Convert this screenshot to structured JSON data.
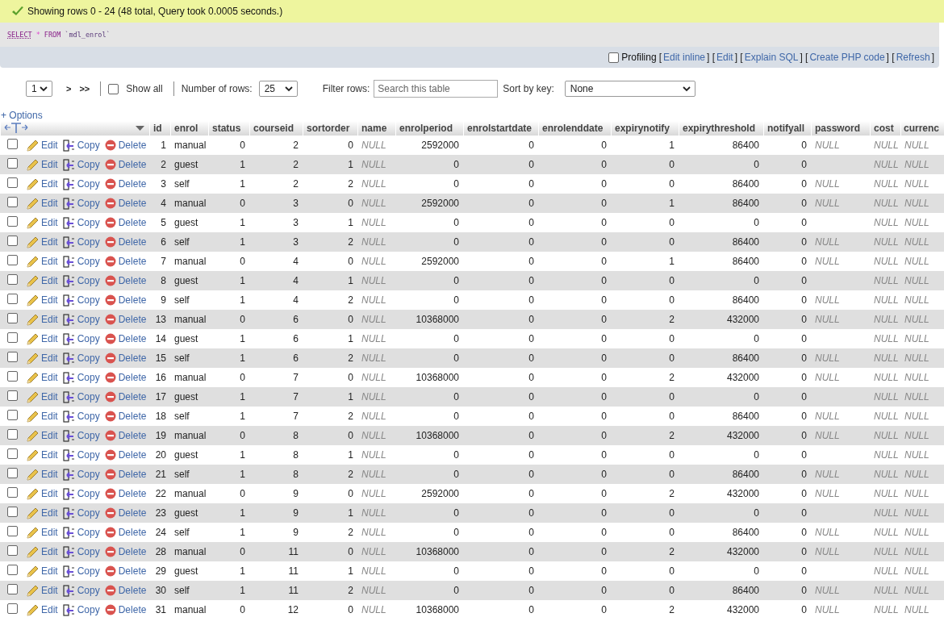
{
  "message": {
    "text": "Showing rows 0 - 24 (48 total, Query took 0.0005 seconds.)"
  },
  "sql": {
    "keyword1": "SELECT",
    "star": "*",
    "keyword2": "FROM",
    "table": "`mdl_enrol`"
  },
  "query_links": {
    "profiling": {
      "label": "Profiling",
      "checked": false
    },
    "items": [
      {
        "kind": "bracket",
        "text": "["
      },
      {
        "kind": "link",
        "text": "Edit inline"
      },
      {
        "kind": "bracket",
        "text": "] ["
      },
      {
        "kind": "link",
        "text": "Edit"
      },
      {
        "kind": "bracket",
        "text": "] ["
      },
      {
        "kind": "link",
        "text": "Explain SQL"
      },
      {
        "kind": "bracket",
        "text": "] ["
      },
      {
        "kind": "link",
        "text": "Create PHP code"
      },
      {
        "kind": "bracket",
        "text": "] ["
      },
      {
        "kind": "link",
        "text": "Refresh"
      },
      {
        "kind": "bracket",
        "text": "]"
      }
    ]
  },
  "navigation": {
    "page": "1",
    "next": ">",
    "last": ">>",
    "show_all": {
      "label": "Show all",
      "checked": false
    },
    "rows_label": "Number of rows:",
    "rows_value": "25",
    "filter_label": "Filter rows:",
    "filter_placeholder": "Search this table",
    "sort_label": "Sort by key:",
    "sort_value": "None"
  },
  "options": "+ Options",
  "table": {
    "columns": [
      "id",
      "enrol",
      "status",
      "courseid",
      "sortorder",
      "name",
      "enrolperiod",
      "enrolstartdate",
      "enrolenddate",
      "expirynotify",
      "expirythreshold",
      "notifyall",
      "password",
      "cost",
      "currenc"
    ],
    "rows": [
      {
        "checked": false,
        "actions": [
          "Edit",
          "Copy",
          "Delete"
        ],
        "cells": [
          "1",
          "manual",
          "0",
          "2",
          "0",
          {
            "text": "NULL",
            "kind": "null"
          },
          "2592000",
          "0",
          "0",
          "1",
          "86400",
          "0",
          {
            "text": "NULL",
            "kind": "null"
          },
          {
            "text": "NULL",
            "kind": "null"
          },
          {
            "text": "NULL",
            "kind": "null"
          }
        ]
      },
      {
        "checked": false,
        "actions": [
          "Edit",
          "Copy",
          "Delete"
        ],
        "cells": [
          "2",
          "guest",
          "1",
          "2",
          "1",
          {
            "text": "NULL",
            "kind": "null"
          },
          "0",
          "0",
          "0",
          "0",
          "0",
          "0",
          {
            "kind": "empty"
          },
          {
            "text": "NULL",
            "kind": "null"
          },
          {
            "text": "NULL",
            "kind": "null"
          }
        ]
      },
      {
        "checked": false,
        "actions": [
          "Edit",
          "Copy",
          "Delete"
        ],
        "cells": [
          "3",
          "self",
          "1",
          "2",
          "2",
          {
            "text": "NULL",
            "kind": "null"
          },
          "0",
          "0",
          "0",
          "0",
          "86400",
          "0",
          {
            "text": "NULL",
            "kind": "null"
          },
          {
            "text": "NULL",
            "kind": "null"
          },
          {
            "text": "NULL",
            "kind": "null"
          }
        ]
      },
      {
        "checked": false,
        "actions": [
          "Edit",
          "Copy",
          "Delete"
        ],
        "cells": [
          "4",
          "manual",
          "0",
          "3",
          "0",
          {
            "text": "NULL",
            "kind": "null"
          },
          "2592000",
          "0",
          "0",
          "1",
          "86400",
          "0",
          {
            "text": "NULL",
            "kind": "null"
          },
          {
            "text": "NULL",
            "kind": "null"
          },
          {
            "text": "NULL",
            "kind": "null"
          }
        ]
      },
      {
        "checked": false,
        "actions": [
          "Edit",
          "Copy",
          "Delete"
        ],
        "cells": [
          "5",
          "guest",
          "1",
          "3",
          "1",
          {
            "text": "NULL",
            "kind": "null"
          },
          "0",
          "0",
          "0",
          "0",
          "0",
          "0",
          {
            "kind": "empty"
          },
          {
            "text": "NULL",
            "kind": "null"
          },
          {
            "text": "NULL",
            "kind": "null"
          }
        ]
      },
      {
        "checked": false,
        "actions": [
          "Edit",
          "Copy",
          "Delete"
        ],
        "cells": [
          "6",
          "self",
          "1",
          "3",
          "2",
          {
            "text": "NULL",
            "kind": "null"
          },
          "0",
          "0",
          "0",
          "0",
          "86400",
          "0",
          {
            "text": "NULL",
            "kind": "null"
          },
          {
            "text": "NULL",
            "kind": "null"
          },
          {
            "text": "NULL",
            "kind": "null"
          }
        ]
      },
      {
        "checked": false,
        "actions": [
          "Edit",
          "Copy",
          "Delete"
        ],
        "cells": [
          "7",
          "manual",
          "0",
          "4",
          "0",
          {
            "text": "NULL",
            "kind": "null"
          },
          "2592000",
          "0",
          "0",
          "1",
          "86400",
          "0",
          {
            "text": "NULL",
            "kind": "null"
          },
          {
            "text": "NULL",
            "kind": "null"
          },
          {
            "text": "NULL",
            "kind": "null"
          }
        ]
      },
      {
        "checked": false,
        "actions": [
          "Edit",
          "Copy",
          "Delete"
        ],
        "cells": [
          "8",
          "guest",
          "1",
          "4",
          "1",
          {
            "text": "NULL",
            "kind": "null"
          },
          "0",
          "0",
          "0",
          "0",
          "0",
          "0",
          {
            "kind": "empty"
          },
          {
            "text": "NULL",
            "kind": "null"
          },
          {
            "text": "NULL",
            "kind": "null"
          }
        ]
      },
      {
        "checked": false,
        "actions": [
          "Edit",
          "Copy",
          "Delete"
        ],
        "cells": [
          "9",
          "self",
          "1",
          "4",
          "2",
          {
            "text": "NULL",
            "kind": "null"
          },
          "0",
          "0",
          "0",
          "0",
          "86400",
          "0",
          {
            "text": "NULL",
            "kind": "null"
          },
          {
            "text": "NULL",
            "kind": "null"
          },
          {
            "text": "NULL",
            "kind": "null"
          }
        ]
      },
      {
        "checked": false,
        "actions": [
          "Edit",
          "Copy",
          "Delete"
        ],
        "cells": [
          "13",
          "manual",
          "0",
          "6",
          "0",
          {
            "text": "NULL",
            "kind": "null"
          },
          "10368000",
          "0",
          "0",
          "2",
          "432000",
          "0",
          {
            "text": "NULL",
            "kind": "null"
          },
          {
            "text": "NULL",
            "kind": "null"
          },
          {
            "text": "NULL",
            "kind": "null"
          }
        ]
      },
      {
        "checked": false,
        "actions": [
          "Edit",
          "Copy",
          "Delete"
        ],
        "cells": [
          "14",
          "guest",
          "1",
          "6",
          "1",
          {
            "text": "NULL",
            "kind": "null"
          },
          "0",
          "0",
          "0",
          "0",
          "0",
          "0",
          {
            "kind": "empty"
          },
          {
            "text": "NULL",
            "kind": "null"
          },
          {
            "text": "NULL",
            "kind": "null"
          }
        ]
      },
      {
        "checked": false,
        "actions": [
          "Edit",
          "Copy",
          "Delete"
        ],
        "cells": [
          "15",
          "self",
          "1",
          "6",
          "2",
          {
            "text": "NULL",
            "kind": "null"
          },
          "0",
          "0",
          "0",
          "0",
          "86400",
          "0",
          {
            "text": "NULL",
            "kind": "null"
          },
          {
            "text": "NULL",
            "kind": "null"
          },
          {
            "text": "NULL",
            "kind": "null"
          }
        ]
      },
      {
        "checked": false,
        "actions": [
          "Edit",
          "Copy",
          "Delete"
        ],
        "cells": [
          "16",
          "manual",
          "0",
          "7",
          "0",
          {
            "text": "NULL",
            "kind": "null"
          },
          "10368000",
          "0",
          "0",
          "2",
          "432000",
          "0",
          {
            "text": "NULL",
            "kind": "null"
          },
          {
            "text": "NULL",
            "kind": "null"
          },
          {
            "text": "NULL",
            "kind": "null"
          }
        ]
      },
      {
        "checked": false,
        "actions": [
          "Edit",
          "Copy",
          "Delete"
        ],
        "cells": [
          "17",
          "guest",
          "1",
          "7",
          "1",
          {
            "text": "NULL",
            "kind": "null"
          },
          "0",
          "0",
          "0",
          "0",
          "0",
          "0",
          {
            "kind": "empty"
          },
          {
            "text": "NULL",
            "kind": "null"
          },
          {
            "text": "NULL",
            "kind": "null"
          }
        ]
      },
      {
        "checked": false,
        "actions": [
          "Edit",
          "Copy",
          "Delete"
        ],
        "cells": [
          "18",
          "self",
          "1",
          "7",
          "2",
          {
            "text": "NULL",
            "kind": "null"
          },
          "0",
          "0",
          "0",
          "0",
          "86400",
          "0",
          {
            "text": "NULL",
            "kind": "null"
          },
          {
            "text": "NULL",
            "kind": "null"
          },
          {
            "text": "NULL",
            "kind": "null"
          }
        ]
      },
      {
        "checked": false,
        "actions": [
          "Edit",
          "Copy",
          "Delete"
        ],
        "cells": [
          "19",
          "manual",
          "0",
          "8",
          "0",
          {
            "text": "NULL",
            "kind": "null"
          },
          "10368000",
          "0",
          "0",
          "2",
          "432000",
          "0",
          {
            "text": "NULL",
            "kind": "null"
          },
          {
            "text": "NULL",
            "kind": "null"
          },
          {
            "text": "NULL",
            "kind": "null"
          }
        ]
      },
      {
        "checked": false,
        "actions": [
          "Edit",
          "Copy",
          "Delete"
        ],
        "cells": [
          "20",
          "guest",
          "1",
          "8",
          "1",
          {
            "text": "NULL",
            "kind": "null"
          },
          "0",
          "0",
          "0",
          "0",
          "0",
          "0",
          {
            "kind": "empty"
          },
          {
            "text": "NULL",
            "kind": "null"
          },
          {
            "text": "NULL",
            "kind": "null"
          }
        ]
      },
      {
        "checked": false,
        "actions": [
          "Edit",
          "Copy",
          "Delete"
        ],
        "cells": [
          "21",
          "self",
          "1",
          "8",
          "2",
          {
            "text": "NULL",
            "kind": "null"
          },
          "0",
          "0",
          "0",
          "0",
          "86400",
          "0",
          {
            "text": "NULL",
            "kind": "null"
          },
          {
            "text": "NULL",
            "kind": "null"
          },
          {
            "text": "NULL",
            "kind": "null"
          }
        ]
      },
      {
        "checked": false,
        "actions": [
          "Edit",
          "Copy",
          "Delete"
        ],
        "cells": [
          "22",
          "manual",
          "0",
          "9",
          "0",
          {
            "text": "NULL",
            "kind": "null"
          },
          "2592000",
          "0",
          "0",
          "2",
          "432000",
          "0",
          {
            "text": "NULL",
            "kind": "null"
          },
          {
            "text": "NULL",
            "kind": "null"
          },
          {
            "text": "NULL",
            "kind": "null"
          }
        ]
      },
      {
        "checked": false,
        "actions": [
          "Edit",
          "Copy",
          "Delete"
        ],
        "cells": [
          "23",
          "guest",
          "1",
          "9",
          "1",
          {
            "text": "NULL",
            "kind": "null"
          },
          "0",
          "0",
          "0",
          "0",
          "0",
          "0",
          {
            "kind": "empty"
          },
          {
            "text": "NULL",
            "kind": "null"
          },
          {
            "text": "NULL",
            "kind": "null"
          }
        ]
      },
      {
        "checked": false,
        "actions": [
          "Edit",
          "Copy",
          "Delete"
        ],
        "cells": [
          "24",
          "self",
          "1",
          "9",
          "2",
          {
            "text": "NULL",
            "kind": "null"
          },
          "0",
          "0",
          "0",
          "0",
          "86400",
          "0",
          {
            "text": "NULL",
            "kind": "null"
          },
          {
            "text": "NULL",
            "kind": "null"
          },
          {
            "text": "NULL",
            "kind": "null"
          }
        ]
      },
      {
        "checked": false,
        "actions": [
          "Edit",
          "Copy",
          "Delete"
        ],
        "cells": [
          "28",
          "manual",
          "0",
          "11",
          "0",
          {
            "text": "NULL",
            "kind": "null"
          },
          "10368000",
          "0",
          "0",
          "2",
          "432000",
          "0",
          {
            "text": "NULL",
            "kind": "null"
          },
          {
            "text": "NULL",
            "kind": "null"
          },
          {
            "text": "NULL",
            "kind": "null"
          }
        ]
      },
      {
        "checked": false,
        "actions": [
          "Edit",
          "Copy",
          "Delete"
        ],
        "cells": [
          "29",
          "guest",
          "1",
          "11",
          "1",
          {
            "text": "NULL",
            "kind": "null"
          },
          "0",
          "0",
          "0",
          "0",
          "0",
          "0",
          {
            "kind": "empty"
          },
          {
            "text": "NULL",
            "kind": "null"
          },
          {
            "text": "NULL",
            "kind": "null"
          }
        ]
      },
      {
        "checked": false,
        "actions": [
          "Edit",
          "Copy",
          "Delete"
        ],
        "cells": [
          "30",
          "self",
          "1",
          "11",
          "2",
          {
            "text": "NULL",
            "kind": "null"
          },
          "0",
          "0",
          "0",
          "0",
          "86400",
          "0",
          {
            "text": "NULL",
            "kind": "null"
          },
          {
            "text": "NULL",
            "kind": "null"
          },
          {
            "text": "NULL",
            "kind": "null"
          }
        ]
      },
      {
        "checked": false,
        "actions": [
          "Edit",
          "Copy",
          "Delete"
        ],
        "cells": [
          "31",
          "manual",
          "0",
          "12",
          "0",
          {
            "text": "NULL",
            "kind": "null"
          },
          "10368000",
          "0",
          "0",
          "2",
          "432000",
          "0",
          {
            "text": "NULL",
            "kind": "null"
          },
          {
            "text": "NULL",
            "kind": "null"
          },
          {
            "text": "NULL",
            "kind": "null"
          }
        ]
      }
    ]
  }
}
